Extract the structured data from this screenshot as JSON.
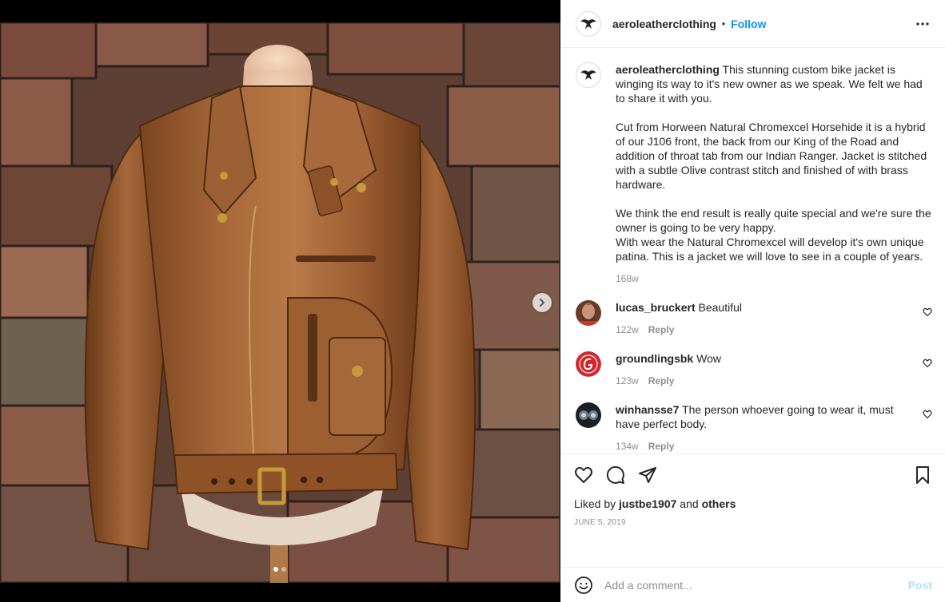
{
  "post": {
    "username": "aeroleatherclothing",
    "separator": "•",
    "follow_label": "Follow",
    "more_icon": "more-horizontal-icon"
  },
  "caption": {
    "username": "aeroleatherclothing",
    "text": " This stunning custom bike jacket is winging its way to it's new owner as we speak. We felt we had to share it with you.\n\nCut from Horween Natural Chromexcel Horsehide it is a hybrid of our J106 front, the back from our King of the Road and addition of throat tab from our Indian Ranger. Jacket is stitched with a subtle Olive contrast stitch and finished of with brass hardware.\n\nWe think the end result is really quite special and we're sure the owner is going to be very happy.\nWith wear the Natural Chromexcel will develop it's own unique patina. This is a jacket we will love to see in a couple of years.",
    "time": "168w"
  },
  "comments": [
    {
      "username": "lucas_bruckert",
      "text": " Beautiful",
      "time": "122w",
      "reply_label": "Reply"
    },
    {
      "username": "groundlingsbk",
      "text": " Wow",
      "time": "123w",
      "reply_label": "Reply"
    },
    {
      "username": "winhansse7",
      "text": " The person whoever going to wear it, must have perfect body.",
      "time": "134w",
      "reply_label": "Reply"
    }
  ],
  "engagement": {
    "liked_prefix": "Liked by ",
    "liked_user": "justbe1907",
    "liked_and": " and ",
    "liked_others": "others",
    "date": "JUNE 5, 2019"
  },
  "add_comment": {
    "placeholder": "Add a comment...",
    "post_label": "Post"
  },
  "carousel": {
    "current_index": 1,
    "total": 2
  },
  "colors": {
    "accent": "#0095f6",
    "post_disabled": "#b2dffc",
    "muted": "#8e8e8e",
    "text": "#262626"
  }
}
